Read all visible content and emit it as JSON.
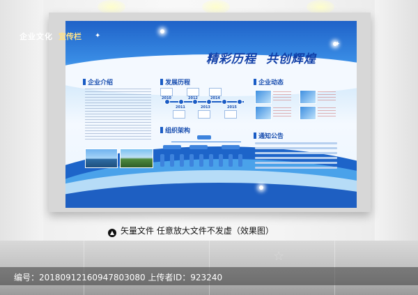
{
  "board": {
    "header_left": "企业文化",
    "header_tag": "宣传栏",
    "slogan_part1": "精彩历程",
    "slogan_part2": "共创辉煌"
  },
  "sections": {
    "intro": "企业介绍",
    "history": "发展历程",
    "news": "企业动态",
    "org": "组织架构",
    "notice": "通知公告"
  },
  "timeline": {
    "years": [
      "2010",
      "2011",
      "2012",
      "2013",
      "2014",
      "2015"
    ]
  },
  "caption": {
    "icon": "up-arrow-icon",
    "text": "矢量文件 任意放大文件不发虚（效果图）"
  },
  "footer": {
    "text": "编号：20180912160947803080 上传者ID：923240"
  },
  "colors": {
    "primary_blue": "#1f62c8",
    "accent_yellow": "#ffe38a",
    "slogan_blue": "#0f3ea7"
  }
}
